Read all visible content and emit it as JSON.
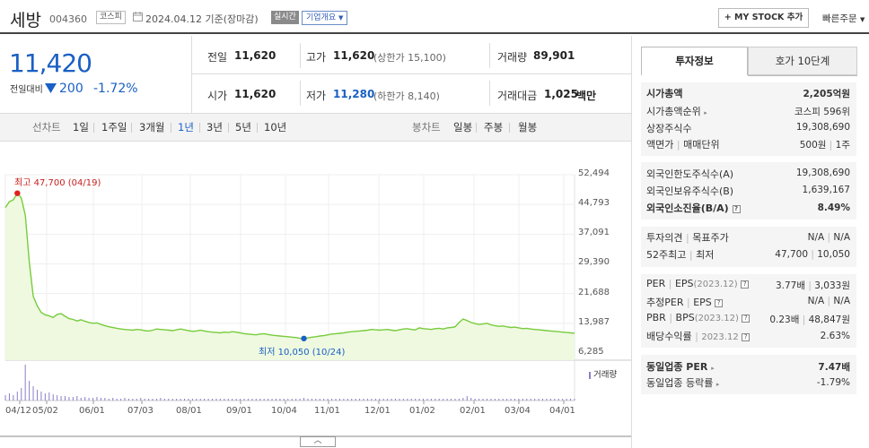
{
  "header": {
    "name": "세방",
    "code": "004360",
    "market": "코스피",
    "date": "2024.04.12 기준(장마감)",
    "realtime": "실시간",
    "company_info": "기업개요",
    "mystock_button": "+ MY STOCK 추가",
    "quick_order": "빠른주문"
  },
  "price": {
    "current": "11,420",
    "diff_label": "전일대비",
    "diff_value": "200",
    "diff_pct": "-1.72%"
  },
  "summary": {
    "prev_label": "전일",
    "prev_value": "11,620",
    "high_label": "고가",
    "high_value": "11,620",
    "upper_limit": "(상한가 15,100)",
    "volume_label": "거래량",
    "volume_value": "89,901",
    "open_label": "시가",
    "open_value": "11,620",
    "low_label": "저가",
    "low_value": "11,280",
    "lower_limit": "(하한가 8,140)",
    "amount_label": "거래대금",
    "amount_value": "1,025",
    "amount_unit": "백만"
  },
  "period": {
    "line_chart_label": "선차트",
    "line_items": [
      "1일",
      "1주일",
      "3개월",
      "1년",
      "3년",
      "5년",
      "10년"
    ],
    "active": "1년",
    "candle_label": "봉차트",
    "candle_items": [
      "일봉",
      "주봉",
      "월봉"
    ]
  },
  "chart_data": {
    "type": "line",
    "x_ticks": [
      "04/12",
      "05/02",
      "06/01",
      "07/03",
      "08/01",
      "09/01",
      "10/04",
      "11/01",
      "12/01",
      "01/02",
      "02/01",
      "03/04",
      "04/01"
    ],
    "y_ticks": [
      "52,494",
      "44,793",
      "37,091",
      "29,390",
      "21,688",
      "13,987",
      "6,285"
    ],
    "ylim": [
      6285,
      52494
    ],
    "series": [
      {
        "values": [
          44000,
          45500,
          46000,
          47700,
          46500,
          42000,
          30000,
          21000,
          18500,
          16800,
          16200,
          15900,
          15500,
          16300,
          16500,
          15800,
          15200,
          15000,
          14600,
          14900,
          14500,
          14200,
          14000,
          14100,
          13700,
          13400,
          13100,
          12900,
          12700,
          12500,
          12400,
          12300,
          12200,
          12400,
          12300,
          12100,
          12000,
          12200,
          12500,
          12400,
          12300,
          12200,
          12100,
          12300,
          12500,
          12300,
          12100,
          11900,
          12000,
          12200,
          12000,
          11800,
          11700,
          11600,
          11500,
          11700,
          11600,
          11800,
          11700,
          11500,
          11300,
          11200,
          11100,
          11000,
          11200,
          11300,
          11100,
          10900,
          10800,
          10700,
          10600,
          10500,
          10400,
          10300,
          10100,
          10050,
          10200,
          10400,
          10500,
          10700,
          10800,
          11000,
          11200,
          11300,
          11400,
          11500,
          11700,
          11800,
          11900,
          12000,
          12100,
          12200,
          12400,
          12300,
          12200,
          12300,
          12400,
          12200,
          12100,
          12300,
          12500,
          12600,
          12400,
          12300,
          12800,
          12600,
          12500,
          12400,
          12600,
          12700,
          12500,
          12800,
          12900,
          13100,
          14200,
          15100,
          14700,
          14200,
          13900,
          13700,
          13800,
          14000,
          13600,
          13400,
          13200,
          13300,
          13100,
          12900,
          13000,
          12800,
          12600,
          12700,
          12500,
          12400,
          12300,
          12200,
          12100,
          12000,
          11900,
          11800,
          11700,
          11600,
          11500,
          11420
        ]
      }
    ],
    "annotations": {
      "max": "최고 47,700 (04/19)",
      "min": "최저 10,050 (10/24)"
    },
    "volume_label": "거래량"
  },
  "right_panel": {
    "tab_active": "투자정보",
    "tab_inactive": "호가 10단계",
    "rows_a": [
      {
        "label": "시가총액",
        "value": "2,205억원",
        "bold": true
      },
      {
        "label": "시가총액순위",
        "value": "코스피 596위"
      },
      {
        "label": "상장주식수",
        "value": "19,308,690"
      },
      {
        "label": "액면가",
        "label2": "매매단위",
        "value": "500원",
        "value2": "1주"
      }
    ],
    "rows_b": [
      {
        "label": "외국인한도주식수(A)",
        "value": "19,308,690"
      },
      {
        "label": "외국인보유주식수(B)",
        "value": "1,639,167"
      },
      {
        "label": "외국인소진율(B/A)",
        "value": "8.49%",
        "bold": true
      }
    ],
    "rows_c": [
      {
        "label": "투자의견",
        "label2": "목표주가",
        "value": "N/A",
        "value2": "N/A"
      },
      {
        "label": "52주최고",
        "label2": "최저",
        "value": "47,700",
        "value2": "10,050"
      }
    ],
    "rows_d": [
      {
        "label": "PER",
        "label2": "EPS",
        "sub": "(2023.12)",
        "value": "3.77배",
        "value2": "3,033원"
      },
      {
        "label": "추정PER",
        "label2": "EPS",
        "value": "N/A",
        "value2": "N/A"
      },
      {
        "label": "PBR",
        "label2": "BPS",
        "sub": "(2023.12)",
        "value": "0.23배",
        "value2": "48,847원"
      },
      {
        "label": "배당수익률",
        "sub": "2023.12",
        "value": "2.63%"
      }
    ],
    "rows_e": [
      {
        "label": "동일업종 PER",
        "value": "7.47배",
        "bold": true
      },
      {
        "label": "동일업종 등락률",
        "value": "-1.79%"
      }
    ]
  }
}
